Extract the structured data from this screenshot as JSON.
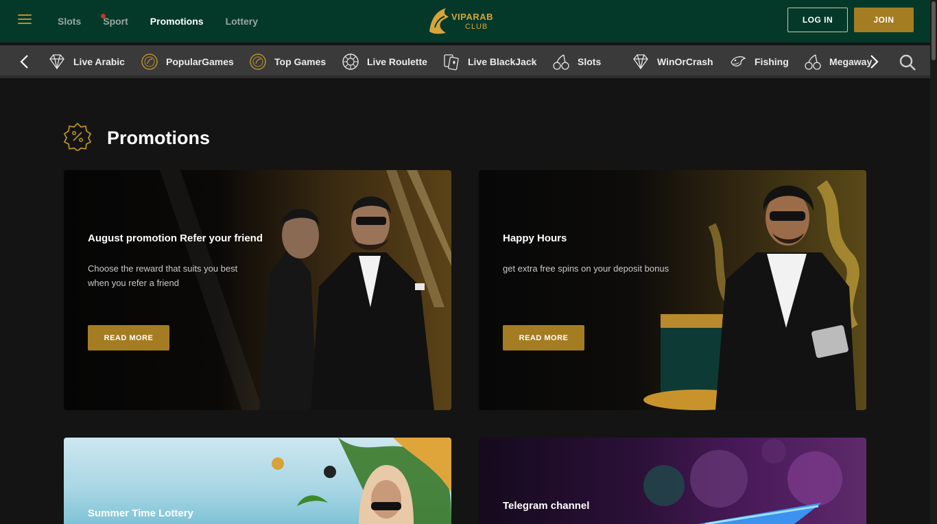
{
  "header": {
    "nav": [
      {
        "label": "Slots",
        "active": false
      },
      {
        "label": "Sport",
        "active": false,
        "badge_dot": true
      },
      {
        "label": "Promotions",
        "active": true
      },
      {
        "label": "Lottery",
        "active": false
      }
    ],
    "logo": {
      "name": "VIPARAB",
      "sub": "CLUB"
    },
    "login_label": "LOG IN",
    "join_label": "JOIN"
  },
  "categories": [
    {
      "label": "Live Arabic",
      "icon": "diamond-icon"
    },
    {
      "label": "PopularGames",
      "icon": "coin-icon"
    },
    {
      "label": "Top Games",
      "icon": "coin-icon"
    },
    {
      "label": "Live Roulette",
      "icon": "roulette-icon"
    },
    {
      "label": "Live BlackJack",
      "icon": "cards-icon"
    },
    {
      "label": "Slots",
      "icon": "cherries-icon"
    },
    {
      "label": "WinOrCrash",
      "icon": "diamond-icon"
    },
    {
      "label": "Fishing",
      "icon": "fish-icon"
    },
    {
      "label": "Megaway",
      "icon": "cherries-icon"
    }
  ],
  "page": {
    "title": "Promotions"
  },
  "promotions": [
    {
      "title": "August promotion Refer your friend",
      "desc": "Choose the reward that suits you best when you refer a friend",
      "button": "READ MORE"
    },
    {
      "title": "Happy Hours",
      "desc": "get extra free spins on your deposit bonus",
      "button": "READ MORE"
    },
    {
      "title": "Summer Time Lottery"
    },
    {
      "title": "Telegram channel"
    }
  ],
  "colors": {
    "header_bg": "#04392a",
    "accent_gold": "#a47c22",
    "category_bar": "#3a3a3a",
    "page_bg": "#141414"
  }
}
